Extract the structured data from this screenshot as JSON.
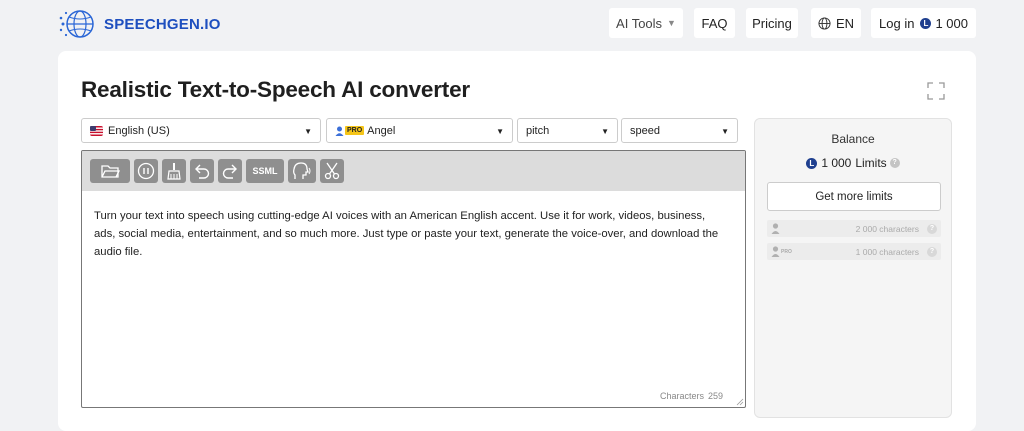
{
  "header": {
    "logo_text": "SPEECHGEN.IO",
    "nav": {
      "ai_tools": "AI Tools",
      "faq": "FAQ",
      "pricing": "Pricing",
      "lang": "EN",
      "login": "Log in",
      "login_balance": "1 000"
    }
  },
  "main": {
    "title": "Realistic Text-to-Speech AI converter",
    "selects": {
      "language": "English (US)",
      "voice_badge": "PRO",
      "voice": "Angel",
      "pitch": "pitch",
      "speed": "speed"
    },
    "toolbar": {
      "icons": [
        "folder-icon",
        "pause-icon",
        "clean-icon",
        "undo-icon",
        "redo-icon",
        "ssml",
        "voice-icon",
        "cut-icon"
      ],
      "ssml_label": "SSML"
    },
    "editor": {
      "text": "Turn your text into speech using cutting-edge AI voices with an American English accent. Use it for work, videos, business, ads, social media, entertainment, and so much more. Just type or paste your text, generate the voice-over, and download the audio file.",
      "char_label": "Characters",
      "char_count": "259"
    }
  },
  "balance": {
    "title": "Balance",
    "amount": "1 000",
    "unit": "Limits",
    "help": "?",
    "button": "Get more limits",
    "tiers": [
      {
        "badge": "",
        "chars": "2 000 characters"
      },
      {
        "badge": "PRO",
        "chars": "1 000 characters"
      }
    ]
  },
  "colors": {
    "accent": "#1e4fbf",
    "coin": "#1f3f8f",
    "pro_badge": "#f5c518",
    "toolbar_button": "#8f8f8f"
  }
}
